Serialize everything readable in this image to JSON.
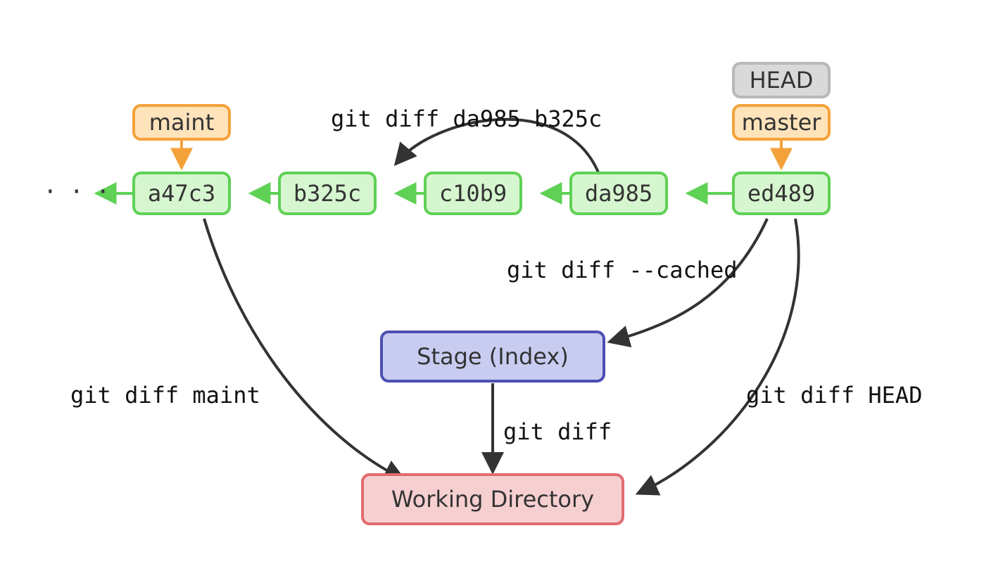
{
  "refs": {
    "head": "HEAD",
    "master": "master",
    "maint": "maint"
  },
  "commits": {
    "c0": "a47c3",
    "c1": "b325c",
    "c2": "c10b9",
    "c3": "da985",
    "c4": "ed489"
  },
  "areas": {
    "stage": "Stage (Index)",
    "workdir": "Working Directory"
  },
  "cmds": {
    "diff_commits": "git diff da985 b325c",
    "diff_cached": "git diff --cached",
    "diff_maint": "git diff maint",
    "diff_plain": "git diff",
    "diff_head": "git diff HEAD"
  },
  "misc": {
    "dots": "· · ·"
  },
  "colors": {
    "commit_fill": "#d6f6cf",
    "commit_stroke": "#5fd155",
    "ref_fill": "#ffe3bb",
    "ref_stroke": "#f3a23a",
    "head_fill": "#d9d9d9",
    "head_stroke": "#b8b8b8",
    "stage_fill": "#c9ccf1",
    "stage_stroke": "#4d4fb4",
    "work_fill": "#f6cfd1",
    "work_stroke": "#e26b6e",
    "arrow_dark": "#333333"
  }
}
